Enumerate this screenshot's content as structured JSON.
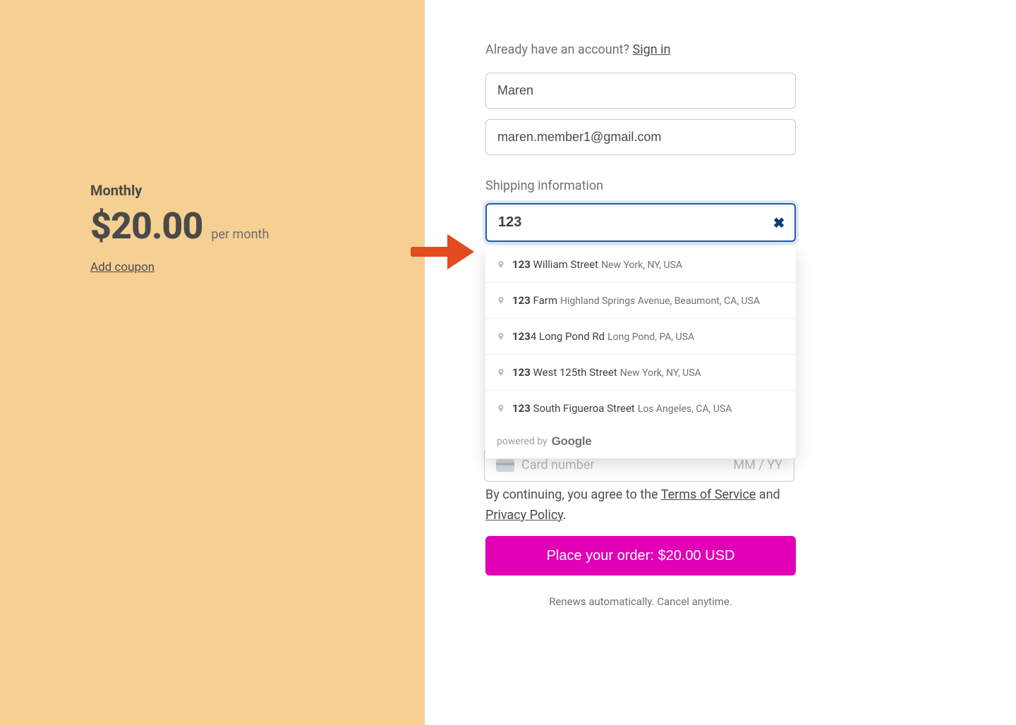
{
  "plan": {
    "name": "Monthly",
    "price": "$20.00",
    "period": "per month",
    "coupon_link": "Add coupon"
  },
  "account": {
    "prompt_prefix": "Already have an account? ",
    "signin_label": "Sign in",
    "name_value": "Maren",
    "email_value": "maren.member1@gmail.com"
  },
  "shipping": {
    "section_label": "Shipping information",
    "address_value": "123",
    "suggestions": [
      {
        "match": "123",
        "rest": " William Street",
        "sub": "New York, NY, USA"
      },
      {
        "match": "123",
        "rest": " Farm",
        "sub": "Highland Springs Avenue, Beaumont, CA, USA"
      },
      {
        "match": "123",
        "rest": "4 Long Pond Rd",
        "sub": "Long Pond, PA, USA"
      },
      {
        "match": "123",
        "rest": " West 125th Street",
        "sub": "New York, NY, USA"
      },
      {
        "match": "123",
        "rest": " South Figueroa Street",
        "sub": "Los Angeles, CA, USA"
      }
    ],
    "powered_by_prefix": "powered by ",
    "powered_by_brand": "Google"
  },
  "payment": {
    "card_placeholder": "Card number",
    "expiry_placeholder": "MM / YY"
  },
  "legal": {
    "prefix": "By continuing, you agree to the ",
    "tos": "Terms of Service",
    "mid": " and ",
    "privacy": "Privacy Policy",
    "suffix": "."
  },
  "cta": {
    "place_order": "Place your order: $20.00 USD",
    "renew_note": "Renews automatically. Cancel anytime."
  }
}
